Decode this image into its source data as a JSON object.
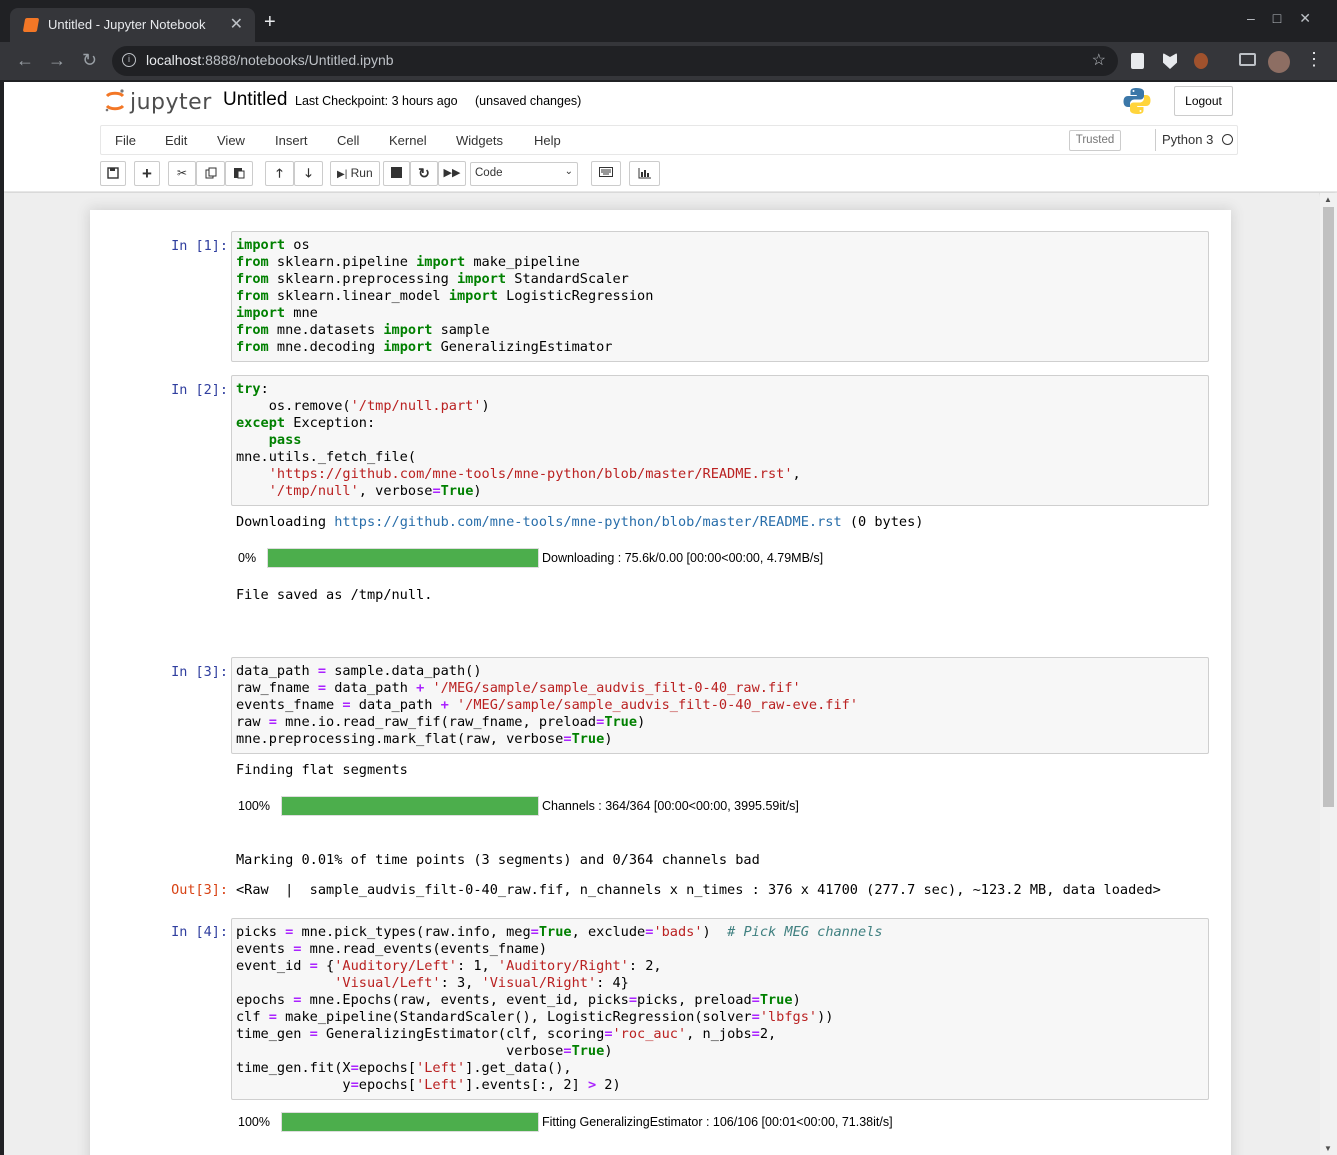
{
  "browser": {
    "tab_title": "Untitled - Jupyter Notebook",
    "new_tab": "+",
    "url_host": "localhost",
    "url_rest": ":8888/notebooks/Untitled.ipynb"
  },
  "jupyter": {
    "logo_text": "jupyter",
    "notebook_name": "Untitled",
    "checkpoint": "Last Checkpoint: 3 hours ago",
    "unsaved": "(unsaved changes)",
    "logout": "Logout",
    "menus": [
      "File",
      "Edit",
      "View",
      "Insert",
      "Cell",
      "Kernel",
      "Widgets",
      "Help"
    ],
    "trusted": "Trusted",
    "kernel": "Python 3",
    "run_label": "Run",
    "cell_type": "Code"
  },
  "cells": [
    {
      "prompt": "In [1]:",
      "code": [
        "import os",
        "from sklearn.pipeline import make_pipeline",
        "from sklearn.preprocessing import StandardScaler",
        "from sklearn.linear_model import LogisticRegression",
        "import mne",
        "from mne.datasets import sample",
        "from mne.decoding import GeneralizingEstimator"
      ]
    },
    {
      "prompt": "In [2]:",
      "code": [
        "try:",
        "    os.remove('/tmp/null.part')",
        "except Exception:",
        "    pass",
        "mne.utils._fetch_file(",
        "    'https://github.com/mne-tools/mne-python/blob/master/README.rst',",
        "    '/tmp/null', verbose=True)"
      ],
      "out_downloading_prefix": "Downloading ",
      "out_downloading_url": "https://github.com/mne-tools/mne-python/blob/master/README.rst",
      "out_downloading_suffix": " (0 bytes)",
      "progress": {
        "pct": "0%",
        "fraction": 1.0,
        "text": "Downloading : 75.6k/0.00 [00:00<00:00, 4.79MB/s]"
      },
      "out_saved": "File saved as /tmp/null."
    },
    {
      "prompt": "In [3]:",
      "code": [
        "data_path = sample.data_path()",
        "raw_fname = data_path + '/MEG/sample/sample_audvis_filt-0-40_raw.fif'",
        "events_fname = data_path + '/MEG/sample/sample_audvis_filt-0-40_raw-eve.fif'",
        "raw = mne.io.read_raw_fif(raw_fname, preload=True)",
        "mne.preprocessing.mark_flat(raw, verbose=True)"
      ],
      "out_finding": "Finding flat segments",
      "progress": {
        "pct": "100%",
        "fraction": 1.0,
        "text": "Channels : 364/364 [00:00<00:00, 3995.59it/s]"
      },
      "out_marking": "Marking 0.01% of time points (3 segments) and 0/364 channels bad",
      "out_prompt": "Out[3]:",
      "out_result": "<Raw  |  sample_audvis_filt-0-40_raw.fif, n_channels x n_times : 376 x 41700 (277.7 sec), ~123.2 MB, data loaded>"
    },
    {
      "prompt": "In [4]:",
      "code": [
        "picks = mne.pick_types(raw.info, meg=True, exclude='bads')  # Pick MEG channels",
        "events = mne.read_events(events_fname)",
        "event_id = {'Auditory/Left': 1, 'Auditory/Right': 2,",
        "            'Visual/Left': 3, 'Visual/Right': 4}",
        "epochs = mne.Epochs(raw, events, event_id, picks=picks, preload=True)",
        "clf = make_pipeline(StandardScaler(), LogisticRegression(solver='lbfgs'))",
        "time_gen = GeneralizingEstimator(clf, scoring='roc_auc', n_jobs=2,",
        "                                 verbose=True)",
        "time_gen.fit(X=epochs['Left'].get_data(),",
        "             y=epochs['Left'].events[:, 2] > 2)"
      ],
      "progress": {
        "pct": "100%",
        "fraction": 1.0,
        "text": "Fitting GeneralizingEstimator : 106/106 [00:01<00:00, 71.38it/s]"
      }
    }
  ]
}
